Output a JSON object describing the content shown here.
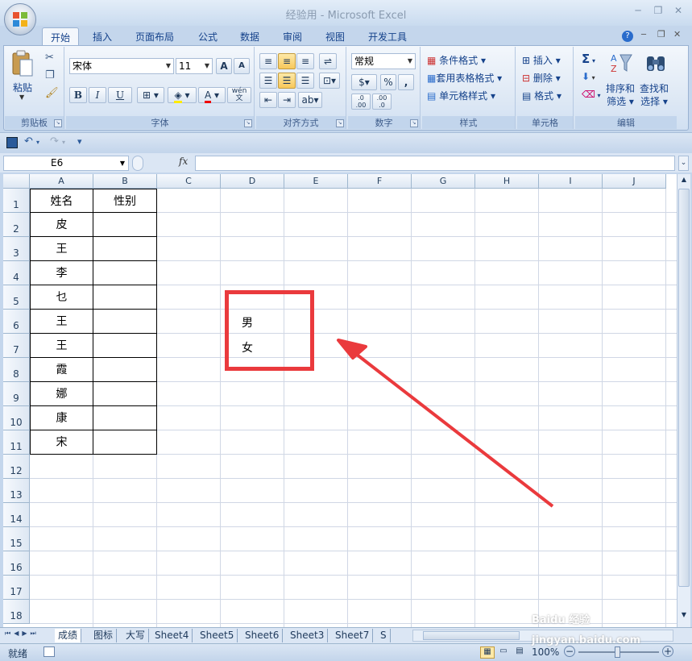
{
  "window": {
    "title": "经验用 - Microsoft Excel",
    "min_label": "─",
    "restore_label": "❐",
    "close_label": "✕"
  },
  "tabs": [
    {
      "label": "开始",
      "active": true
    },
    {
      "label": "插入"
    },
    {
      "label": "页面布局"
    },
    {
      "label": "公式"
    },
    {
      "label": "数据"
    },
    {
      "label": "审阅"
    },
    {
      "label": "视图"
    },
    {
      "label": "开发工具"
    }
  ],
  "ribbon": {
    "clipboard": {
      "paste_label": "粘贴",
      "group_label": "剪贴板"
    },
    "font": {
      "font_name": "宋体",
      "font_size": "11",
      "bold": "B",
      "italic": "I",
      "underline": "U",
      "grow": "A",
      "shrink": "A",
      "phonetic": "wén",
      "phonetic2": "文",
      "group_label": "字体"
    },
    "alignment": {
      "group_label": "对齐方式"
    },
    "number": {
      "format": "常规",
      "percent": "%",
      "comma": ",",
      "inc_decimal": ".0 .00",
      "dec_decimal": ".00 .0",
      "group_label": "数字"
    },
    "styles": {
      "conditional": "条件格式",
      "table_format": "套用表格格式",
      "cell_styles": "单元格样式",
      "group_label": "样式"
    },
    "cells": {
      "insert": "插入",
      "delete": "删除",
      "format": "格式",
      "group_label": "单元格"
    },
    "editing": {
      "sigma": "Σ",
      "sort_label1": "排序和",
      "sort_label2": "筛选",
      "find_label1": "查找和",
      "find_label2": "选择",
      "group_label": "编辑"
    }
  },
  "formula_bar": {
    "name_box": "E6",
    "fx": "fx"
  },
  "columns": [
    "A",
    "B",
    "C",
    "D",
    "E",
    "F",
    "G",
    "H",
    "I",
    "J"
  ],
  "rows": [
    "1",
    "2",
    "3",
    "4",
    "5",
    "6",
    "7",
    "8",
    "9",
    "10",
    "11",
    "12",
    "13",
    "14",
    "15",
    "16",
    "17",
    "18"
  ],
  "table": {
    "header_a": "姓名",
    "header_b": "性别",
    "names": [
      "皮",
      "王",
      "李",
      "乜",
      "王",
      "王",
      "霞",
      "娜",
      "康",
      "宋"
    ]
  },
  "dropdown_values": [
    "男",
    "女"
  ],
  "sheets": [
    "成绩",
    "图标",
    "大写",
    "Sheet4",
    "Sheet5",
    "Sheet6",
    "Sheet3",
    "Sheet7",
    "S"
  ],
  "status": {
    "ready": "就绪",
    "zoom": "100%"
  },
  "watermark": "Baidu 经验 jingyan.baidu.com",
  "colors": {
    "annotation": "#ea3a3d",
    "ribbon": "#dfe9f5",
    "grid_line": "#d0d7e5"
  }
}
